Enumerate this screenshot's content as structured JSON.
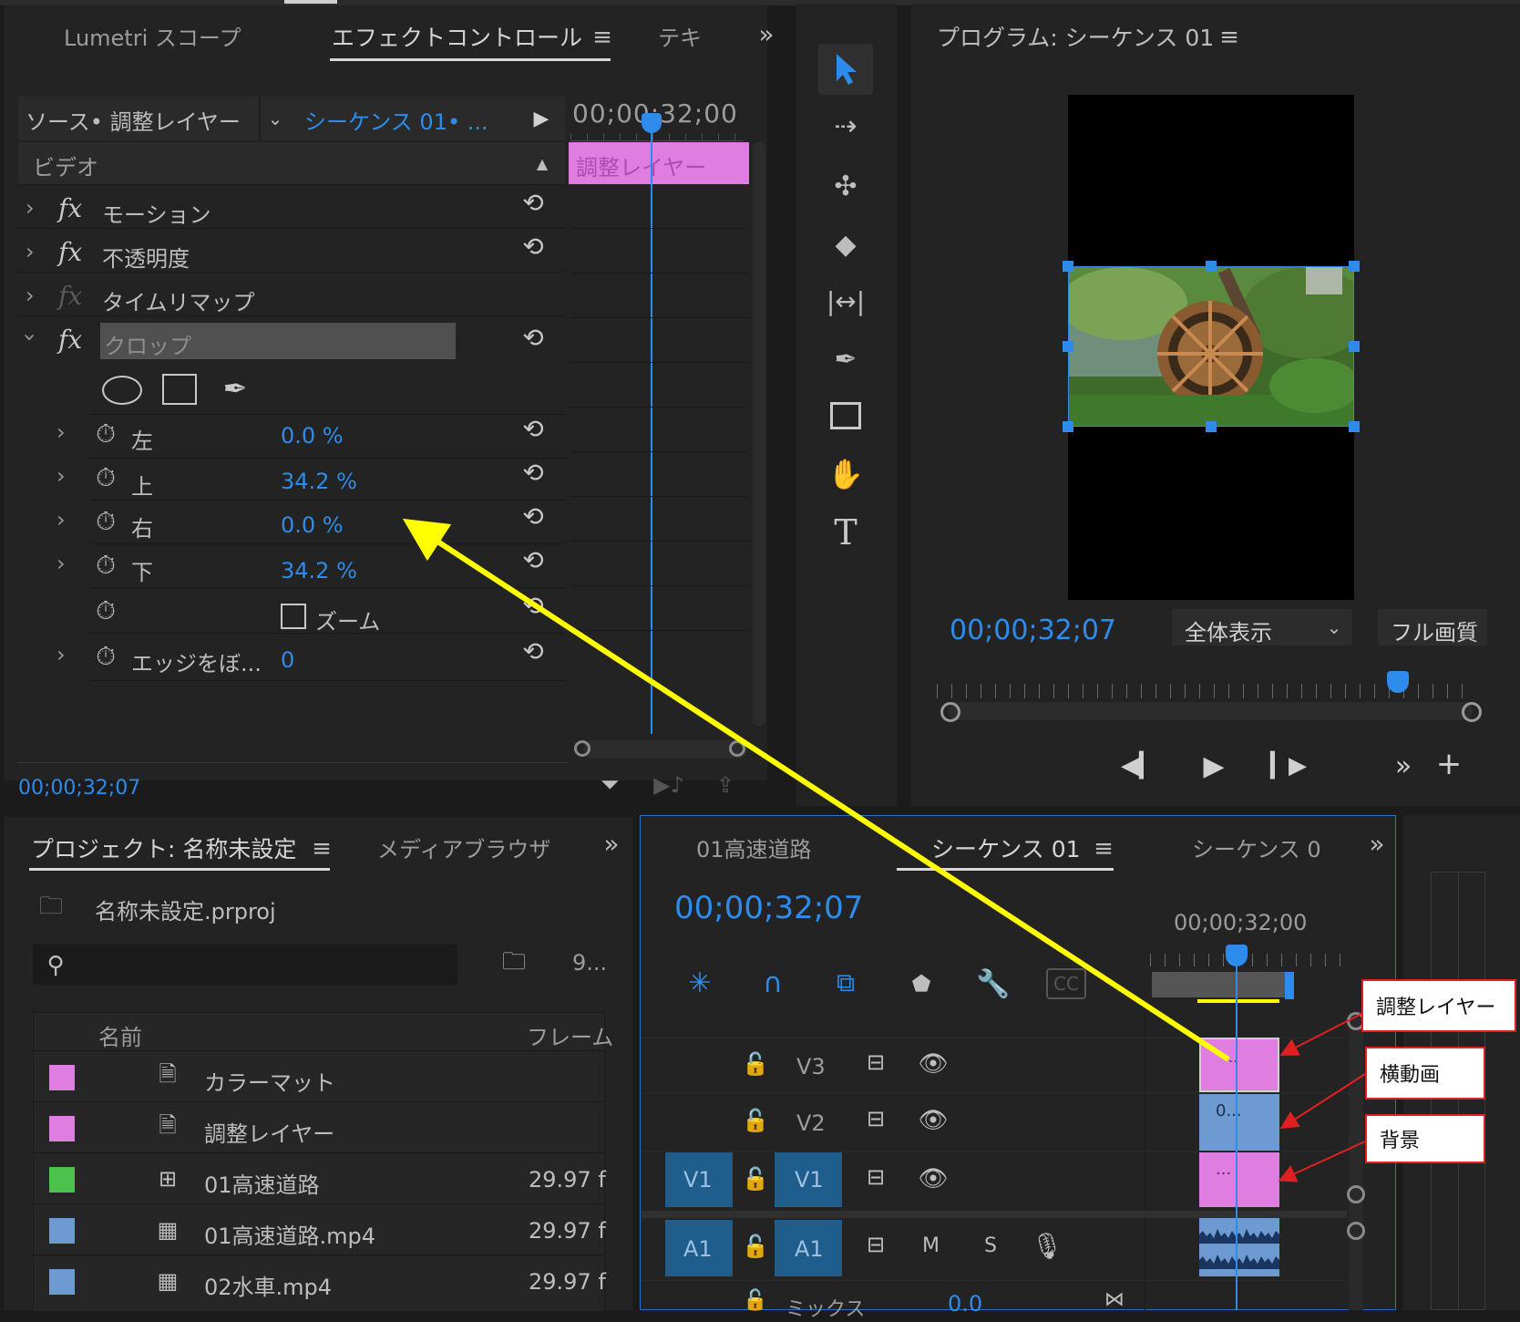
{
  "effect_panel": {
    "tabs": [
      "Lumetri スコープ",
      "エフェクトコントロール",
      "テキ"
    ],
    "source_label": "ソース• 調整レイヤー",
    "sequence_label": "シーケンス 01• ...",
    "timecode_header": "00;00;32;00",
    "clip_label": "調整レイヤー",
    "video_header": "ビデオ",
    "effects": [
      {
        "name": "モーション"
      },
      {
        "name": "不透明度"
      },
      {
        "name": "タイムリマップ"
      },
      {
        "name": "クロップ"
      }
    ],
    "params": [
      {
        "label": "左",
        "value": "0.0 %"
      },
      {
        "label": "上",
        "value": "34.2 %"
      },
      {
        "label": "右",
        "value": "0.0 %"
      },
      {
        "label": "下",
        "value": "34.2 %"
      },
      {
        "label": "ズーム",
        "value": ""
      },
      {
        "label": "エッジをぼ...",
        "value": "0"
      }
    ],
    "footer_timecode": "00;00;32;07"
  },
  "program_monitor": {
    "title": "プログラム: シーケンス 01",
    "timecode": "00;00;32;07",
    "zoom_select": "全体表示",
    "quality_select": "フル画質"
  },
  "project_panel": {
    "tabs": [
      "プロジェクト: 名称未設定",
      "メディアブラウザ"
    ],
    "file_name": "名称未設定.prproj",
    "search_placeholder": "",
    "count": "9...",
    "col_name": "名前",
    "col_frame": "フレーム",
    "items": [
      {
        "name": "カラーマット",
        "fps": "",
        "color": "#e07de0",
        "icon": "matte-icon"
      },
      {
        "name": "調整レイヤー",
        "fps": "",
        "color": "#e07de0",
        "icon": "adjustment-layer-icon"
      },
      {
        "name": "01高速道路",
        "fps": "29.97 f",
        "color": "#4cc24c",
        "icon": "sequence-icon"
      },
      {
        "name": "01高速道路.mp4",
        "fps": "29.97 f",
        "color": "#6c9ad1",
        "icon": "video-file-icon"
      },
      {
        "name": "02水車.mp4",
        "fps": "29.97 f",
        "color": "#6c9ad1",
        "icon": "video-file-icon"
      }
    ]
  },
  "timeline": {
    "tabs": [
      "01高速道路",
      "シーケンス 01",
      "シーケンス 0"
    ],
    "timecode": "00;00;32;07",
    "ruler_time": "00;00;32;00",
    "tracks": [
      {
        "name": "V3",
        "src": ""
      },
      {
        "name": "V2",
        "src": ""
      },
      {
        "name": "V1",
        "src": "V1"
      },
      {
        "name": "A1",
        "src": "A1"
      }
    ],
    "audio_buttons": [
      "M",
      "S"
    ],
    "mix_label": "ミックス",
    "mix_value": "0.0",
    "clips": [
      {
        "track": "V3",
        "label": "..",
        "color": "#e07de0"
      },
      {
        "track": "V2",
        "label": "0...",
        "color": "#6c9ad1"
      },
      {
        "track": "V1",
        "label": "...",
        "color": "#e07de0"
      }
    ]
  },
  "callouts": [
    "調整レイヤー",
    "横動画",
    "背景"
  ],
  "colors": {
    "accent": "#2d8ceb",
    "clip_pink": "#e07de0",
    "clip_blue": "#6c9ad1",
    "arrow_yellow": "#ffff00",
    "callout_red": "#e02020"
  }
}
